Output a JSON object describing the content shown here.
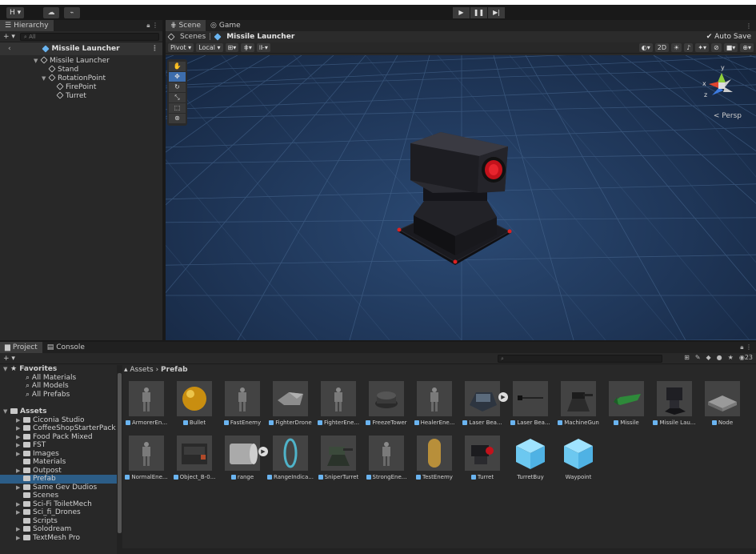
{
  "topbar": {
    "account": "H ▾",
    "cloud_icon": "cloud-icon",
    "collab_icon": "collab-icon",
    "play_icon": "▶",
    "pause_icon": "❚❚",
    "step_icon": "▶|"
  },
  "hierarchy": {
    "tab": "Hierarchy",
    "add": "+ ▾",
    "search_placeholder": "All",
    "header": "Missile Launcher",
    "items": [
      {
        "label": "Missile Launcher",
        "depth": 0,
        "expanded": true
      },
      {
        "label": "Stand",
        "depth": 1
      },
      {
        "label": "RotationPoint",
        "depth": 1,
        "expanded": true
      },
      {
        "label": "FirePoint",
        "depth": 2
      },
      {
        "label": "Turret",
        "depth": 2
      }
    ]
  },
  "scene": {
    "tabs": [
      "Scene",
      "Game"
    ],
    "breadcrumb_root": "Scenes",
    "breadcrumb_current": "Missile Launcher",
    "auto_save": "Auto Save",
    "pivot": "Pivot ▾",
    "local": "Local ▾",
    "mode_2d": "2D",
    "persp": "< Persp",
    "gizmo_y": "y",
    "gizmo_x": "x",
    "gizmo_z": "z"
  },
  "project": {
    "tabs": [
      "Project",
      "Console"
    ],
    "add": "+ ▾",
    "breadcrumb": [
      "Assets",
      "Prefab"
    ],
    "hidden_count": "23",
    "favorites": {
      "title": "Favorites",
      "items": [
        "All Materials",
        "All Models",
        "All Prefabs"
      ]
    },
    "assets": {
      "title": "Assets",
      "folders": [
        "Ciconia Studio",
        "CoffeeShopStarterPack",
        "Food Pack Mixed",
        "FST",
        "Images",
        "Materials",
        "Outpost",
        "Prefab",
        "Same Gev Dudios",
        "Scenes",
        "Sci-Fi ToiletMech",
        "Sci_fi_Drones",
        "Scripts",
        "Solodream",
        "TextMesh Pro"
      ]
    },
    "grid": [
      {
        "label": "ArmorerEn...",
        "kind": "figure"
      },
      {
        "label": "Bullet",
        "kind": "sphere"
      },
      {
        "label": "FastEnemy",
        "kind": "figure"
      },
      {
        "label": "FighterDrone",
        "kind": "drone"
      },
      {
        "label": "FighterEne...",
        "kind": "figure"
      },
      {
        "label": "FreezeTower",
        "kind": "tower"
      },
      {
        "label": "HealerEne...",
        "kind": "figure"
      },
      {
        "label": "Laser Bea...",
        "kind": "laser",
        "play": true
      },
      {
        "label": "Laser Bea...",
        "kind": "line"
      },
      {
        "label": "MachineGun",
        "kind": "gun"
      },
      {
        "label": "Missile",
        "kind": "missile"
      },
      {
        "label": "Missile Lau...",
        "kind": "launcher"
      },
      {
        "label": "Node",
        "kind": "node"
      },
      {
        "label": "NormalEne...",
        "kind": "figure"
      },
      {
        "label": "Object_B-0...",
        "kind": "box"
      },
      {
        "label": "range",
        "kind": "cyl",
        "play": true
      },
      {
        "label": "RangeIndica...",
        "kind": "ring"
      },
      {
        "label": "SniperTurret",
        "kind": "sniper"
      },
      {
        "label": "StrongEne...",
        "kind": "figure"
      },
      {
        "label": "TestEnemy",
        "kind": "capsule"
      },
      {
        "label": "Turret",
        "kind": "turret"
      },
      {
        "label": "TurretBuy",
        "kind": "cube"
      },
      {
        "label": "Waypoint",
        "kind": "cube"
      }
    ]
  }
}
